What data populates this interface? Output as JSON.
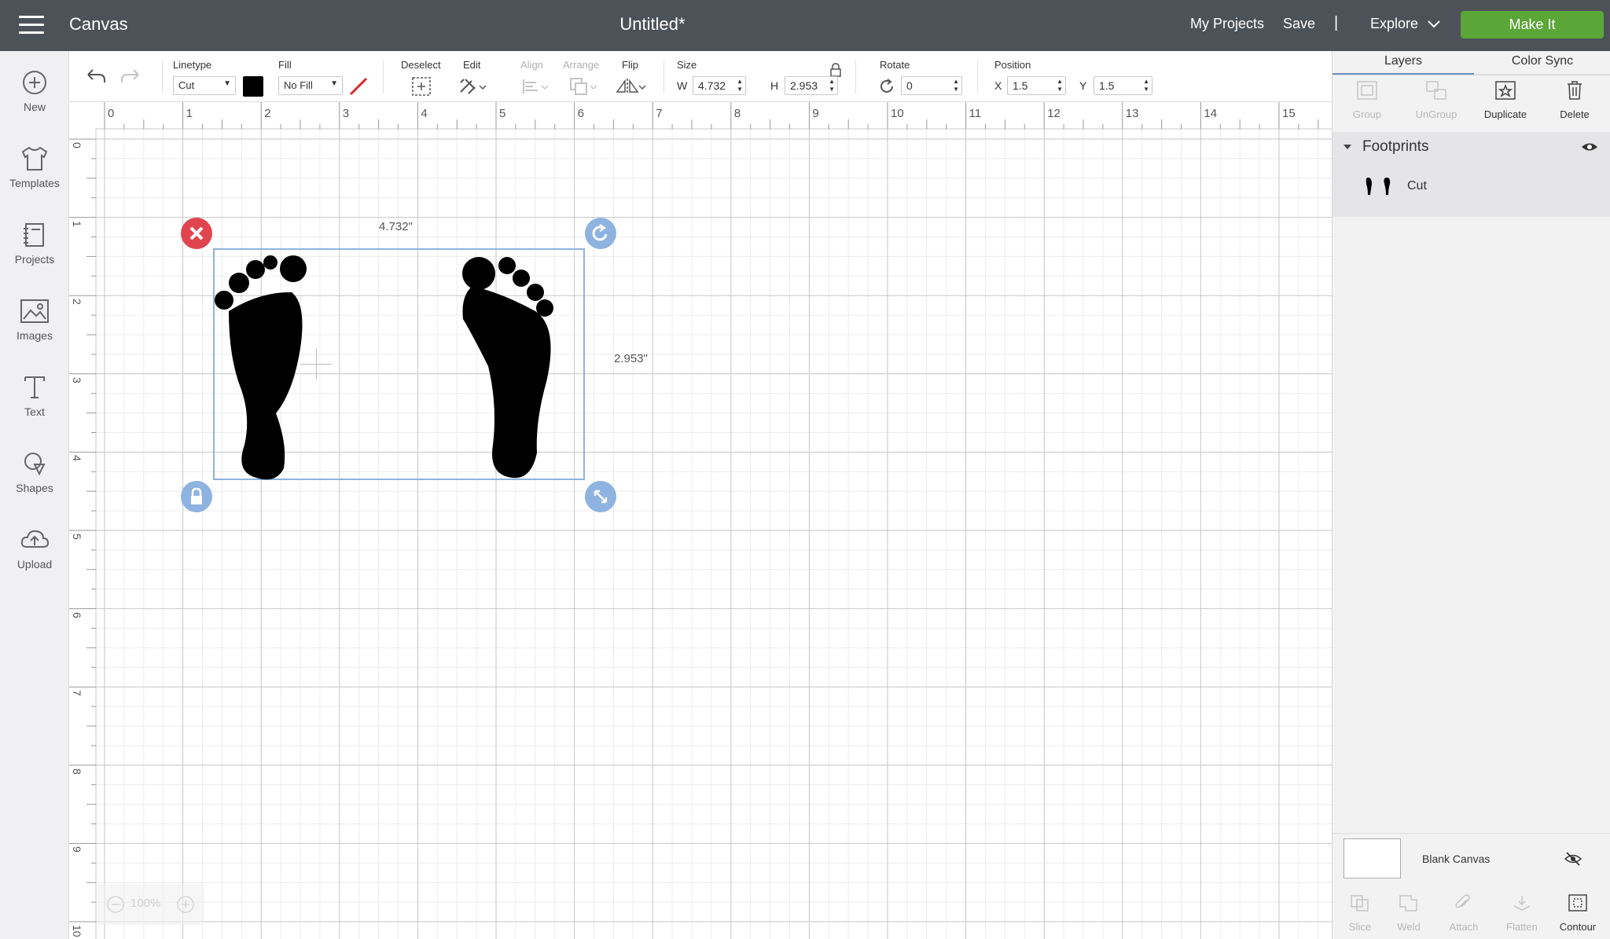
{
  "topbar": {
    "app_title": "Canvas",
    "doc_title": "Untitled*",
    "my_projects": "My Projects",
    "save": "Save",
    "separator": "|",
    "explore": "Explore",
    "make_it": "Make It",
    "make_it_color": "#5aa637",
    "bar_color": "#4d5259"
  },
  "sidebar": {
    "items": [
      {
        "label": "New",
        "icon": "plus-circle-icon"
      },
      {
        "label": "Templates",
        "icon": "tshirt-icon"
      },
      {
        "label": "Projects",
        "icon": "notebook-icon"
      },
      {
        "label": "Images",
        "icon": "image-icon"
      },
      {
        "label": "Text",
        "icon": "text-t-icon"
      },
      {
        "label": "Shapes",
        "icon": "shapes-icon"
      },
      {
        "label": "Upload",
        "icon": "cloud-upload-icon"
      }
    ]
  },
  "toolbar": {
    "linetype_label": "Linetype",
    "linetype_value": "Cut",
    "linetype_color": "#000000",
    "fill_label": "Fill",
    "fill_value": "No Fill",
    "deselect_label": "Deselect",
    "edit_label": "Edit",
    "align_label": "Align",
    "arrange_label": "Arrange",
    "flip_label": "Flip",
    "size_label": "Size",
    "w_label": "W",
    "w_value": "4.732",
    "h_label": "H",
    "h_value": "2.953",
    "rotate_label": "Rotate",
    "rotate_value": "0",
    "position_label": "Position",
    "x_label": "X",
    "x_value": "1.5",
    "y_label": "Y",
    "y_value": "1.5"
  },
  "canvas": {
    "ruler_top": [
      "0",
      "1",
      "2",
      "3",
      "4",
      "5",
      "6",
      "7",
      "8",
      "9",
      "10",
      "11",
      "12",
      "13",
      "14",
      "15"
    ],
    "ruler_left": [
      "0",
      "1",
      "2",
      "3",
      "4",
      "5",
      "6",
      "7",
      "8",
      "9",
      "10"
    ],
    "width_readout": "4.732\"",
    "height_readout": "2.953\"",
    "zoom": "100%",
    "selection_color": "#8eb3e0",
    "delete_handle_color": "#e0454f"
  },
  "layers_panel": {
    "tabs": [
      "Layers",
      "Color Sync"
    ],
    "actions": [
      {
        "label": "Group",
        "enabled": false
      },
      {
        "label": "UnGroup",
        "enabled": false
      },
      {
        "label": "Duplicate",
        "enabled": true
      },
      {
        "label": "Delete",
        "enabled": true
      }
    ],
    "group_name": "Footprints",
    "layer_type": "Cut",
    "blank_canvas": "Blank Canvas",
    "bottom_actions": [
      {
        "label": "Slice",
        "enabled": false
      },
      {
        "label": "Weld",
        "enabled": false
      },
      {
        "label": "Attach",
        "enabled": false
      },
      {
        "label": "Flatten",
        "enabled": false
      },
      {
        "label": "Contour",
        "enabled": true
      }
    ]
  }
}
